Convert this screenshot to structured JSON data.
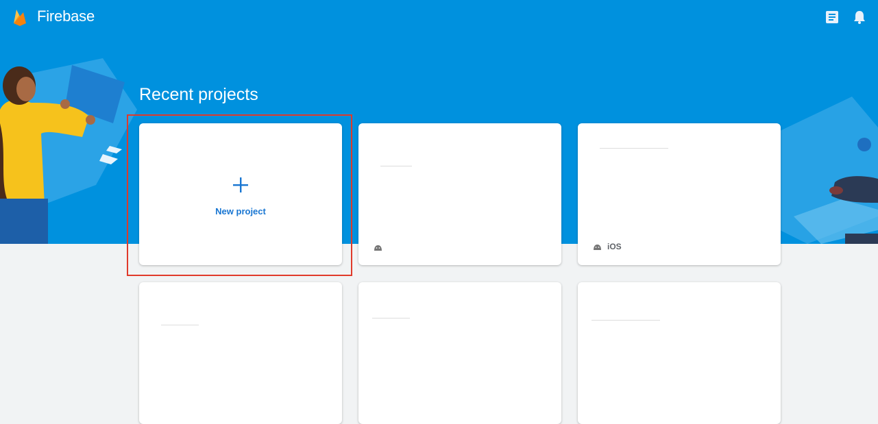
{
  "app": {
    "brand": "Firebase"
  },
  "header": {
    "icons": [
      "docs-icon",
      "bell-icon"
    ]
  },
  "section": {
    "title": "Recent projects"
  },
  "new_project": {
    "label": "New project"
  },
  "projects": [
    {
      "platforms": [
        "android"
      ],
      "platform_text": ""
    },
    {
      "platforms": [
        "android"
      ],
      "platform_text": "iOS"
    },
    {
      "platforms": [],
      "platform_text": ""
    },
    {
      "platforms": [],
      "platform_text": ""
    },
    {
      "platforms": [],
      "platform_text": ""
    }
  ],
  "colors": {
    "hero": "#0091de",
    "background": "#f1f3f4",
    "accent": "#1976d2",
    "highlight": "#e03a2a"
  }
}
